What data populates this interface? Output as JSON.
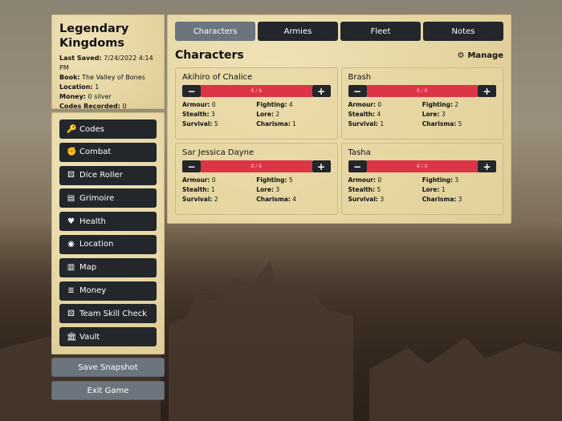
{
  "info": {
    "title": "Legendary Kingdoms",
    "rows": [
      {
        "label": "Last Saved:",
        "value": "7/24/2022 4:14 PM"
      },
      {
        "label": "Book:",
        "value": "The Valley of Bones"
      },
      {
        "label": "Location:",
        "value": "1"
      },
      {
        "label": "Money:",
        "value": "0 silver"
      },
      {
        "label": "Codes Recorded:",
        "value": "0"
      }
    ]
  },
  "menu": [
    {
      "label": "Codes",
      "icon": "key",
      "glyph": "🔑"
    },
    {
      "label": "Combat",
      "icon": "fist",
      "glyph": "✊"
    },
    {
      "label": "Dice Roller",
      "icon": "dice",
      "glyph": "⚄"
    },
    {
      "label": "Grimoire",
      "icon": "book",
      "glyph": "▤"
    },
    {
      "label": "Health",
      "icon": "heart",
      "glyph": "♥"
    },
    {
      "label": "Location",
      "icon": "compass",
      "glyph": "◉"
    },
    {
      "label": "Map",
      "icon": "map",
      "glyph": "▥"
    },
    {
      "label": "Money",
      "icon": "coins",
      "glyph": "≣"
    },
    {
      "label": "Team Skill Check",
      "icon": "dice",
      "glyph": "⚄"
    },
    {
      "label": "Vault",
      "icon": "bank",
      "glyph": "🏛"
    }
  ],
  "buttons": {
    "save": "Save Snapshot",
    "exit": "Exit Game"
  },
  "tabs": [
    "Characters",
    "Armies",
    "Fleet",
    "Notes"
  ],
  "main": {
    "heading": "Characters",
    "manage": "Manage"
  },
  "characters": [
    {
      "name": "Akihiro of Chalice",
      "hp": "8 / 8",
      "stats": [
        [
          "Armour:",
          "0"
        ],
        [
          "Fighting:",
          "4"
        ],
        [
          "Stealth:",
          "3"
        ],
        [
          "Lore:",
          "2"
        ],
        [
          "Survival:",
          "5"
        ],
        [
          "Charisma:",
          "1"
        ]
      ]
    },
    {
      "name": "Brash",
      "hp": "8 / 8",
      "stats": [
        [
          "Armour:",
          "0"
        ],
        [
          "Fighting:",
          "2"
        ],
        [
          "Stealth:",
          "4"
        ],
        [
          "Lore:",
          "3"
        ],
        [
          "Survival:",
          "1"
        ],
        [
          "Charisma:",
          "5"
        ]
      ]
    },
    {
      "name": "Sar Jessica Dayne",
      "hp": "8 / 8",
      "stats": [
        [
          "Armour:",
          "0"
        ],
        [
          "Fighting:",
          "5"
        ],
        [
          "Stealth:",
          "1"
        ],
        [
          "Lore:",
          "3"
        ],
        [
          "Survival:",
          "2"
        ],
        [
          "Charisma:",
          "4"
        ]
      ]
    },
    {
      "name": "Tasha",
      "hp": "8 / 8",
      "stats": [
        [
          "Armour:",
          "0"
        ],
        [
          "Fighting:",
          "3"
        ],
        [
          "Stealth:",
          "5"
        ],
        [
          "Lore:",
          "1"
        ],
        [
          "Survival:",
          "3"
        ],
        [
          "Charisma:",
          "3"
        ]
      ]
    }
  ]
}
